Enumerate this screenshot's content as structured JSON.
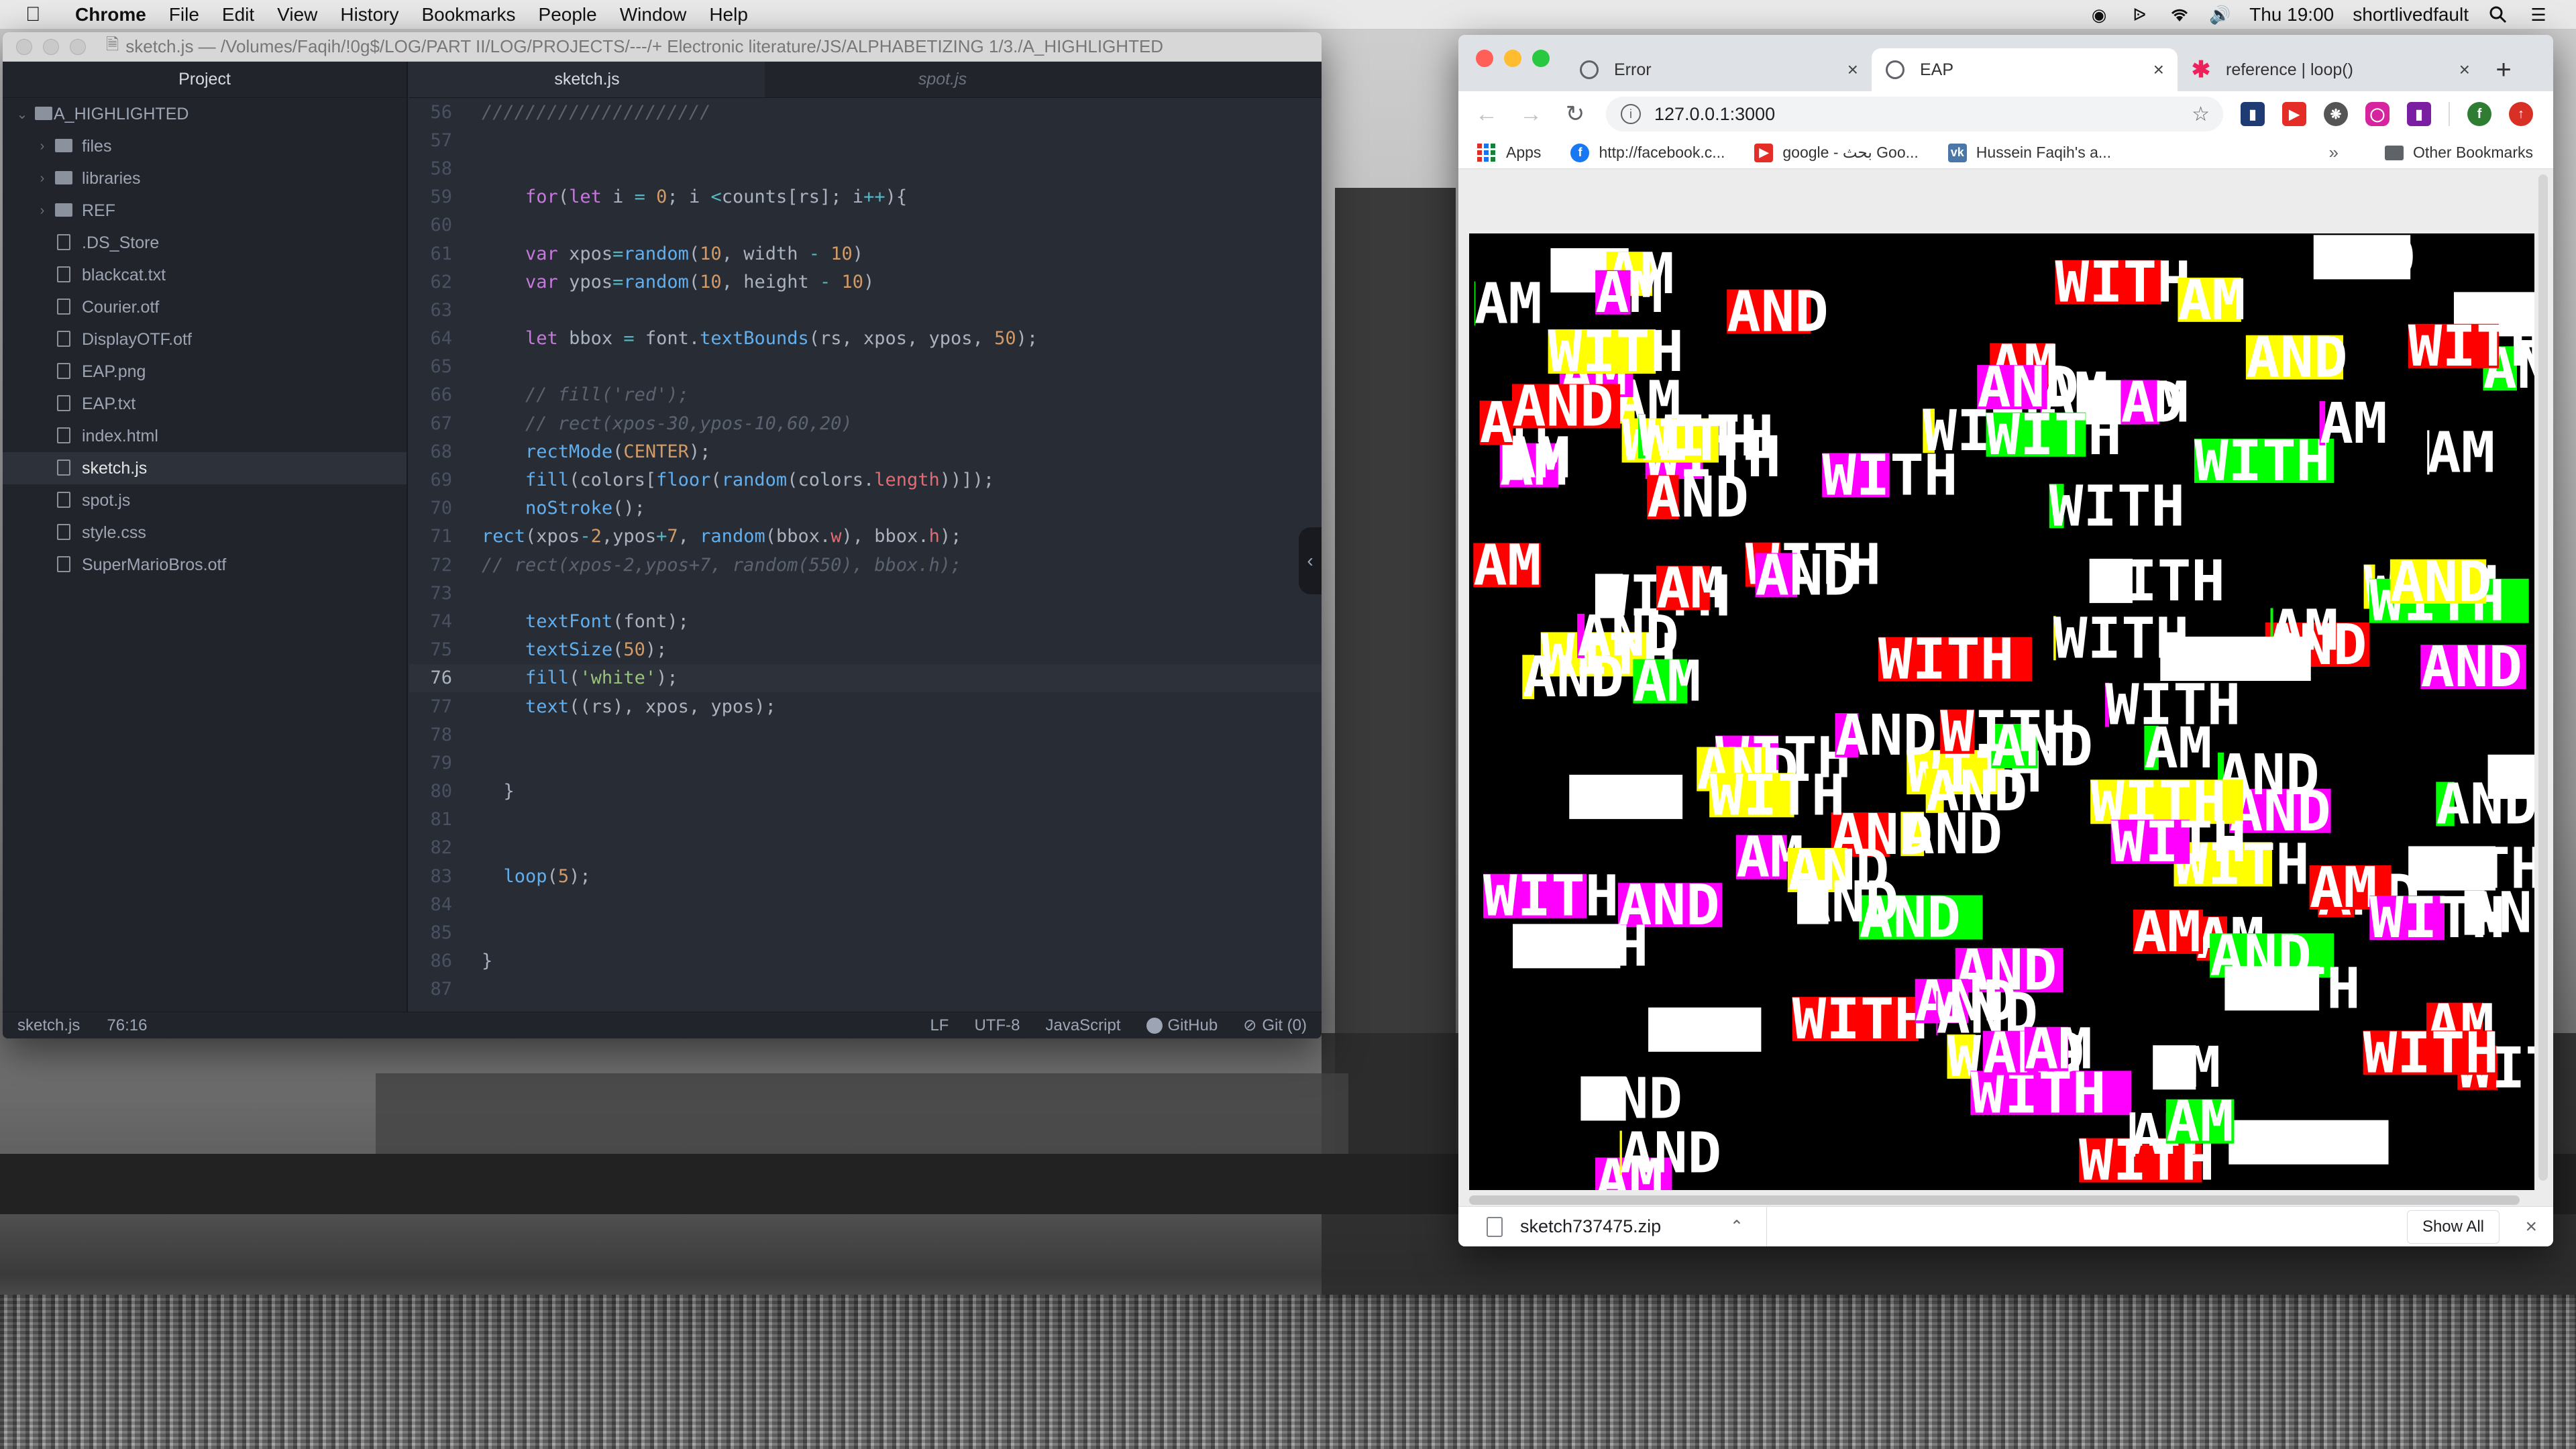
{
  "menubar": {
    "app_name": "Chrome",
    "items": [
      "File",
      "Edit",
      "View",
      "History",
      "Bookmarks",
      "People",
      "Window",
      "Help"
    ],
    "clock": "Thu 19:00",
    "user": "shortlivedfault"
  },
  "editor": {
    "title": "sketch.js — /Volumes/Faqih/!0g$/LOG/PART II/LOG/PROJECTS/---/+ Electronic literature/JS/ALPHABETIZING 1/3./A_HIGHLIGHTED",
    "tree": {
      "header": "Project",
      "root": "A_HIGHLIGHTED",
      "folders": [
        "files",
        "libraries",
        "REF"
      ],
      "files": [
        ".DS_Store",
        "blackcat.txt",
        "Courier.otf",
        "DisplayOTF.otf",
        "EAP.png",
        "EAP.txt",
        "index.html",
        "sketch.js",
        "spot.js",
        "style.css",
        "SuperMarioBros.otf"
      ],
      "selected": "sketch.js"
    },
    "tabs": [
      {
        "label": "sketch.js",
        "active": true
      },
      {
        "label": "spot.js",
        "active": false
      }
    ],
    "cursor_line": 76,
    "status": {
      "file": "sketch.js",
      "position": "76:16",
      "line_ending": "LF",
      "encoding": "UTF-8",
      "grammar": "JavaScript",
      "github": "GitHub",
      "git": "Git (0)"
    }
  },
  "code_lines": [
    {
      "n": 56,
      "html": "<span class='cmt'>/////////////////////</span>"
    },
    {
      "n": 57,
      "html": ""
    },
    {
      "n": 58,
      "html": ""
    },
    {
      "n": 59,
      "html": "    <span class='kw'>for</span>(<span class='kw'>let</span> i <span class='op'>=</span> <span class='num'>0</span>; i <span class='op'>&lt;</span>counts[rs]; i<span class='op'>++</span>){"
    },
    {
      "n": 60,
      "html": ""
    },
    {
      "n": 61,
      "html": "    <span class='kw'>var</span> xpos<span class='op'>=</span><span class='fn'>random</span>(<span class='num'>10</span>, width <span class='op'>-</span> <span class='num'>10</span>)"
    },
    {
      "n": 62,
      "html": "    <span class='kw'>var</span> ypos<span class='op'>=</span><span class='fn'>random</span>(<span class='num'>10</span>, height <span class='op'>-</span> <span class='num'>10</span>)"
    },
    {
      "n": 63,
      "html": ""
    },
    {
      "n": 64,
      "html": "    <span class='kw'>let</span> bbox <span class='op'>=</span> font.<span class='fn'>textBounds</span>(rs, xpos, ypos, <span class='num'>50</span>);"
    },
    {
      "n": 65,
      "html": ""
    },
    {
      "n": 66,
      "html": "    <span class='cmt'>// fill('red');</span>"
    },
    {
      "n": 67,
      "html": "    <span class='cmt'>// rect(xpos-30,ypos-10,60,20)</span>"
    },
    {
      "n": 68,
      "html": "    <span class='fn'>rectMode</span>(<span class='num'>CENTER</span>);"
    },
    {
      "n": 69,
      "html": "    <span class='fn'>fill</span>(colors[<span class='fn'>floor</span>(<span class='fn'>random</span>(colors.<span class='prop'>length</span>))]);"
    },
    {
      "n": 70,
      "html": "    <span class='fn'>noStroke</span>();"
    },
    {
      "n": 71,
      "html": "<span class='fn'>rect</span>(xpos<span class='op'>-</span><span class='num'>2</span>,ypos<span class='op'>+</span><span class='num'>7</span>, <span class='fn'>random</span>(bbox.<span class='prop'>w</span>), bbox.<span class='prop'>h</span>);"
    },
    {
      "n": 72,
      "html": "<span class='cmt'>// rect(xpos-2,ypos+7, random(550), bbox.h);</span>"
    },
    {
      "n": 73,
      "html": ""
    },
    {
      "n": 74,
      "html": "    <span class='fn'>textFont</span>(font);"
    },
    {
      "n": 75,
      "html": "    <span class='fn'>textSize</span>(<span class='num'>50</span>);"
    },
    {
      "n": 76,
      "html": "    <span class='fn'>fill</span>(<span class='str'>'white'</span>);"
    },
    {
      "n": 77,
      "html": "    <span class='fn'>text</span>((rs), xpos, ypos);"
    },
    {
      "n": 78,
      "html": ""
    },
    {
      "n": 79,
      "html": ""
    },
    {
      "n": 80,
      "html": "  }"
    },
    {
      "n": 81,
      "html": ""
    },
    {
      "n": 82,
      "html": ""
    },
    {
      "n": 83,
      "html": "  <span class='fn'>loop</span>(<span class='num'>5</span>);"
    },
    {
      "n": 84,
      "html": ""
    },
    {
      "n": 85,
      "html": ""
    },
    {
      "n": 86,
      "html": "}"
    },
    {
      "n": 87,
      "html": ""
    }
  ],
  "chrome": {
    "tabs": [
      {
        "label": "Error",
        "active": false,
        "icon": "globe-icon"
      },
      {
        "label": "EAP",
        "active": true,
        "icon": "globe-icon"
      },
      {
        "label": "reference | loop()",
        "active": false,
        "icon": "p5-asterisk-icon"
      }
    ],
    "url": "127.0.0.1:3000",
    "bookmarks": [
      {
        "label": "Apps",
        "icon": "apps-grid-icon"
      },
      {
        "label": "http://facebook.c...",
        "icon": "facebook-icon"
      },
      {
        "label": "google - بحث Goo...",
        "icon": "youtube-icon"
      },
      {
        "label": "Hussein Faqih's a...",
        "icon": "vk-icon"
      }
    ],
    "other_bookmarks": "Other Bookmarks",
    "download": {
      "file": "sketch737475.zip",
      "show_all": "Show All"
    }
  },
  "canvas": {
    "words": [
      "AND",
      "AM",
      "WITH"
    ],
    "fill_colors": [
      "#ff0000",
      "#ffff00",
      "#00ff00",
      "#ff00ff",
      "#ffffff"
    ],
    "background": "#000000"
  }
}
